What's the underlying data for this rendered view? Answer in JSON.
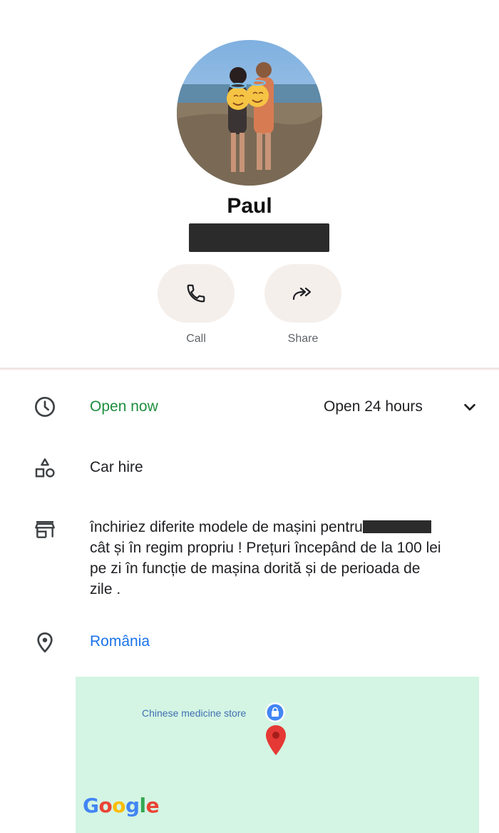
{
  "profile": {
    "name": "Paul"
  },
  "actions": {
    "call_label": "Call",
    "share_label": "Share"
  },
  "hours": {
    "status": "Open now",
    "detail": "Open 24 hours"
  },
  "category": "Car hire",
  "description": {
    "line1": "închiriez diferite modele de mașini pentru",
    "line2": "cât și în regim propriu ! Prețuri începând de la 100 lei",
    "line3": "pe zi în funcție de mașina dorită și de perioada de",
    "line4": "zile ."
  },
  "location": "România",
  "map": {
    "poi_label": "Chinese medicine store",
    "logo": {
      "g1": "G",
      "o1": "o",
      "o2": "o",
      "g2": "g",
      "l": "l",
      "e": "e"
    }
  },
  "colors": {
    "open_green": "#1e8e3e",
    "link_blue": "#1a73e8",
    "map_green": "#d4f5e3",
    "pin_red": "#e53935",
    "button_bg": "#f5efec"
  },
  "icons": {
    "call": "phone-icon",
    "share": "share-arrow-icon",
    "hours": "clock-icon",
    "category": "shapes-icon",
    "description": "store-icon",
    "location": "location-pin-icon",
    "expand": "chevron-down-icon"
  }
}
